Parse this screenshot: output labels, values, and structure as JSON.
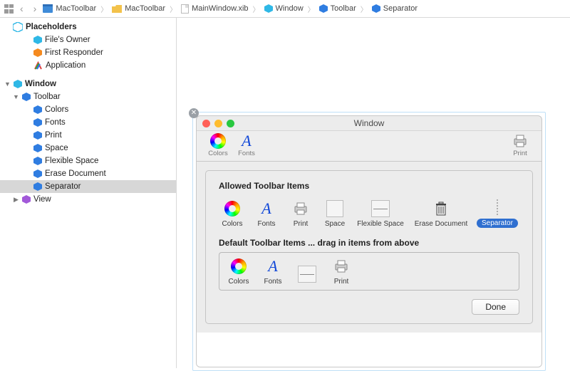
{
  "breadcrumbs": [
    {
      "label": "MacToolbar",
      "icon": "project"
    },
    {
      "label": "MacToolbar",
      "icon": "folder"
    },
    {
      "label": "MainWindow.xib",
      "icon": "xib"
    },
    {
      "label": "Window",
      "icon": "cube-cyan"
    },
    {
      "label": "Toolbar",
      "icon": "cube-blue"
    },
    {
      "label": "Separator",
      "icon": "cube-blue"
    }
  ],
  "outline": {
    "placeholders_header": "Placeholders",
    "files_owner": "File's Owner",
    "first_responder": "First Responder",
    "application": "Application",
    "window_header": "Window",
    "toolbar": "Toolbar",
    "toolbar_children": [
      "Colors",
      "Fonts",
      "Print",
      "Space",
      "Flexible Space",
      "Erase Document",
      "Separator"
    ],
    "view": "View"
  },
  "mock": {
    "window_title": "Window",
    "toolbar_items": {
      "colors": "Colors",
      "fonts": "Fonts",
      "print": "Print"
    },
    "sheet": {
      "allowed_header": "Allowed Toolbar Items",
      "allowed": [
        "Colors",
        "Fonts",
        "Print",
        "Space",
        "Flexible Space",
        "Erase Document",
        "Separator"
      ],
      "default_header": "Default Toolbar Items ... drag in items from above",
      "default": [
        "Colors",
        "Fonts",
        "",
        "Print"
      ],
      "done": "Done"
    }
  }
}
